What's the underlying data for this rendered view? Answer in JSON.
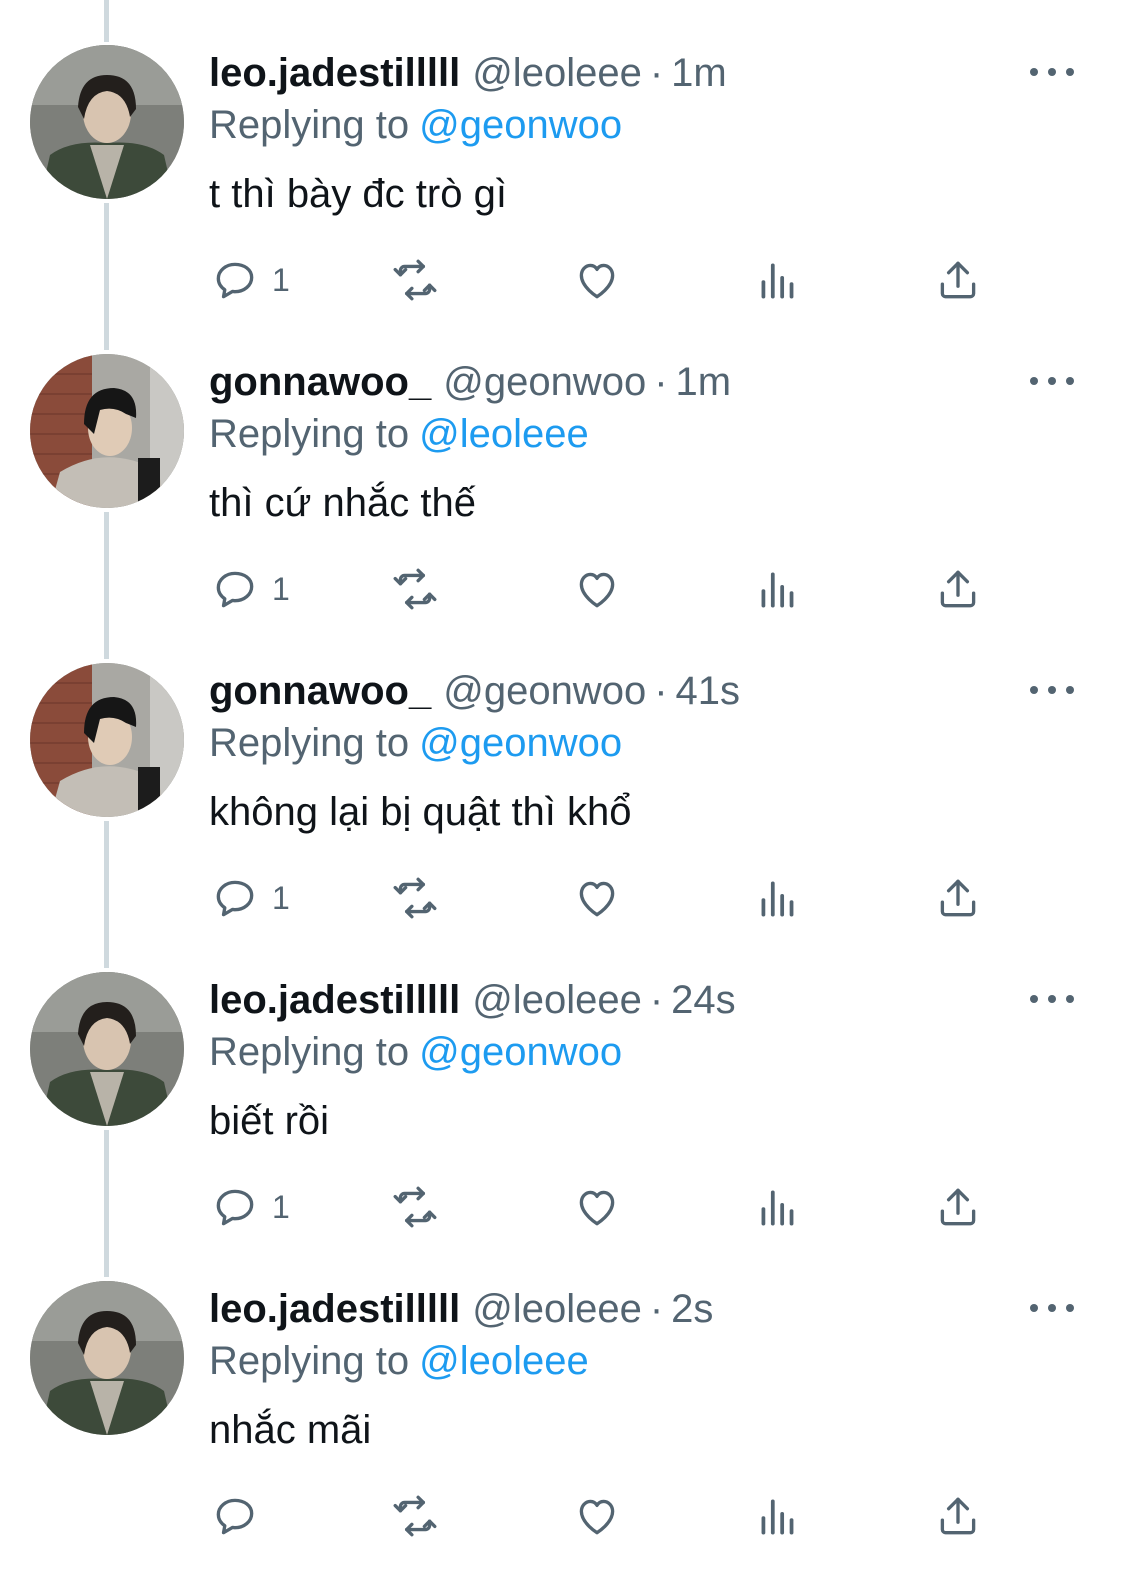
{
  "tweets": [
    {
      "display_name": "leo.jadestilllll",
      "handle": "@leoleee",
      "separator": "·",
      "time": "1m",
      "replying_to_label": "Replying to",
      "replying_to": "@geonwoo",
      "text": "t thì bày đc trò gì",
      "reply_count": "1",
      "avatar": "avatar-leo"
    },
    {
      "display_name": "gonnawoo_",
      "handle": "@geonwoo",
      "separator": "·",
      "time": "1m",
      "replying_to_label": "Replying to",
      "replying_to": "@leoleee",
      "text": "thì cứ nhắc thế",
      "reply_count": "1",
      "avatar": "avatar-gonnawoo"
    },
    {
      "display_name": "gonnawoo_",
      "handle": "@geonwoo",
      "separator": "·",
      "time": "41s",
      "replying_to_label": "Replying to",
      "replying_to": "@geonwoo",
      "text": "không lại bị quật thì khổ",
      "reply_count": "1",
      "avatar": "avatar-gonnawoo"
    },
    {
      "display_name": "leo.jadestilllll",
      "handle": "@leoleee",
      "separator": "·",
      "time": "24s",
      "replying_to_label": "Replying to",
      "replying_to": "@geonwoo",
      "text": "biết rồi",
      "reply_count": "1",
      "avatar": "avatar-leo"
    },
    {
      "display_name": "leo.jadestilllll",
      "handle": "@leoleee",
      "separator": "·",
      "time": "2s",
      "replying_to_label": "Replying to",
      "replying_to": "@leoleee",
      "text": "nhắc mãi",
      "reply_count": "",
      "avatar": "avatar-leo"
    }
  ],
  "icons": {
    "reply": "reply-icon",
    "retweet": "retweet-icon",
    "like": "heart-icon",
    "views": "views-icon",
    "share": "share-icon",
    "more": "more-icon"
  },
  "colors": {
    "link": "#1d9bf0",
    "secondary": "#536471",
    "primary": "#0f1419",
    "thread_line": "#cfd9de"
  }
}
